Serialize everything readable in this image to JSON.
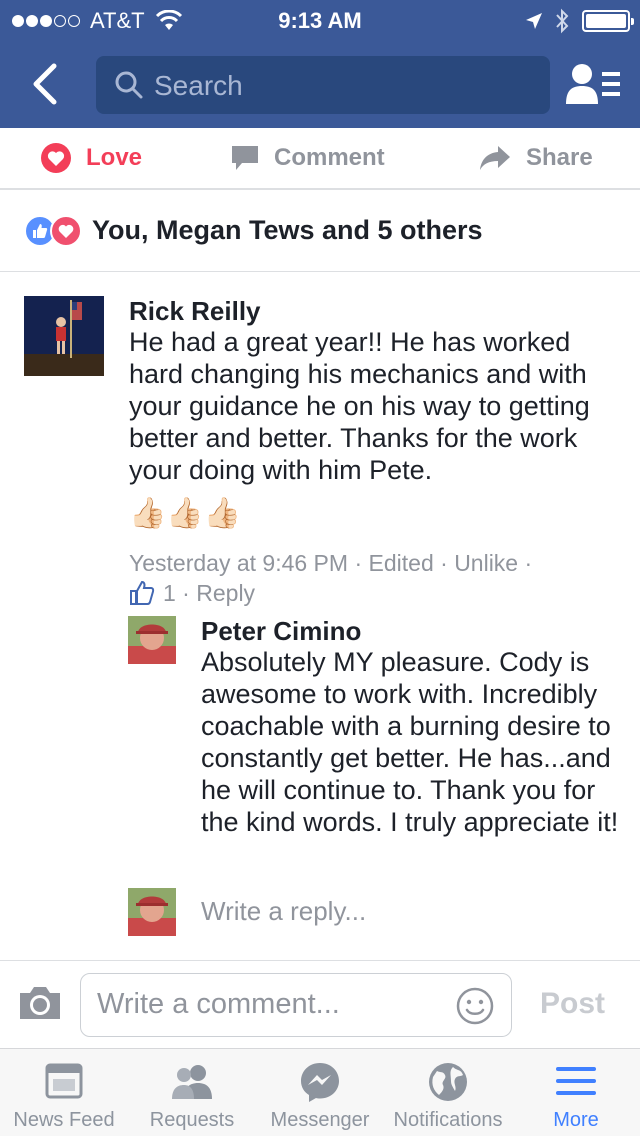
{
  "status_bar": {
    "carrier": "AT&T",
    "time": "9:13 AM",
    "signal_dots_filled": 3,
    "signal_dots_total": 5
  },
  "nav": {
    "search_placeholder": "Search",
    "back_icon": "chevron-left-icon",
    "friends_icon": "friend-list-icon"
  },
  "actions": {
    "love_label": "Love",
    "comment_label": "Comment",
    "share_label": "Share"
  },
  "reactions": {
    "summary": "You, Megan Tews and 5 others"
  },
  "comment": {
    "author": "Rick Reilly",
    "text": "He had a great year!! He has worked hard changing his mechanics and with your guidance he on his way to getting better and better. Thanks for the work your doing with him Pete.",
    "emoji": "👍🏻👍🏻👍🏻",
    "timestamp": "Yesterday at 9:46 PM",
    "edited": "Edited",
    "unlike": "Unlike",
    "like_count": "1",
    "reply": "Reply"
  },
  "reply": {
    "author": "Peter Cimino",
    "text": "Absolutely MY pleasure. Cody is awesome to work with. Incredibly coachable with a burning desire to constantly get better. He has...and he will continue to.  Thank you for the kind words. I truly appreciate it!"
  },
  "write_reply": {
    "placeholder": "Write a reply..."
  },
  "composer": {
    "placeholder": "Write a comment...",
    "post_label": "Post"
  },
  "tabbar": {
    "tabs": [
      {
        "label": "News Feed",
        "icon": "news-feed-icon"
      },
      {
        "label": "Requests",
        "icon": "friend-requests-icon"
      },
      {
        "label": "Messenger",
        "icon": "messenger-icon"
      },
      {
        "label": "Notifications",
        "icon": "globe-icon"
      },
      {
        "label": "More",
        "icon": "hamburger-menu-icon"
      }
    ],
    "active_tab": "More"
  },
  "colors": {
    "brand_blue": "#3b5998",
    "love_red": "#f33e58",
    "active_tab": "#4080ff",
    "muted_text": "#90949c"
  }
}
